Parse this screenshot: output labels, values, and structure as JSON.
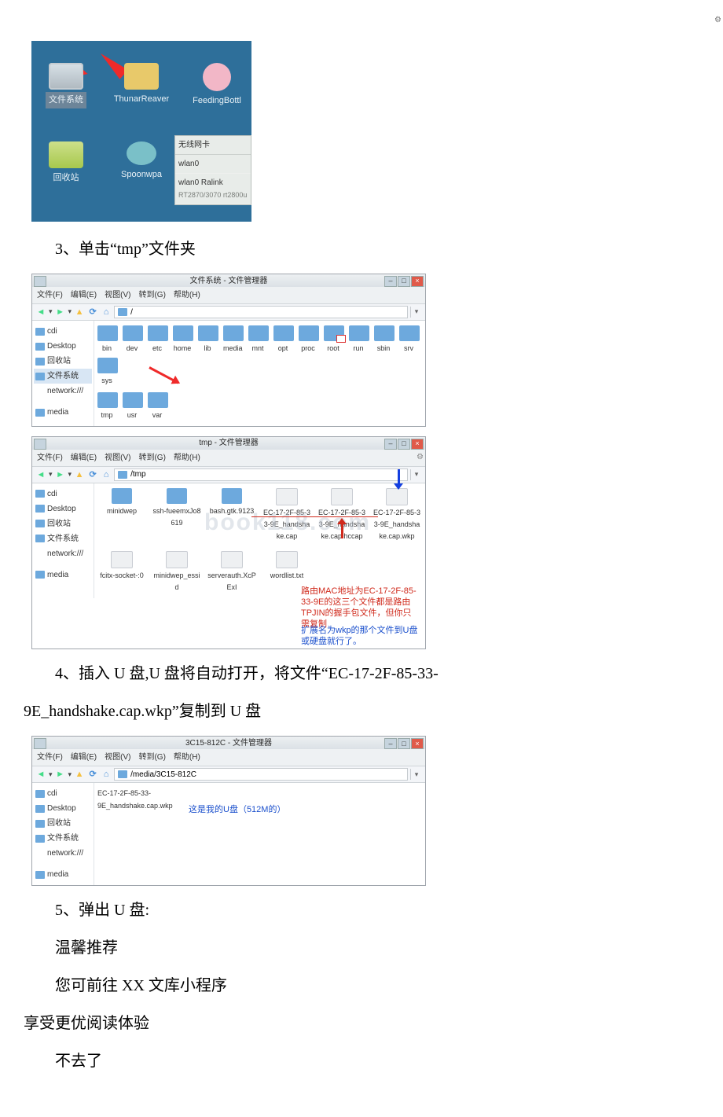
{
  "shot1": {
    "arrow_target": "文件系统",
    "icons": {
      "fs": "文件系统",
      "thunar": "ThunarReaver",
      "feeding": "FeedingBottl",
      "trash": "回收站",
      "spoon": "Spoonwpa"
    },
    "panel": {
      "title": "无线网卡",
      "row1": "wlan0",
      "row2a": "wlan0 Ralink",
      "row2b": "RT2870/3070 rt2800u"
    }
  },
  "p3": "3、单击“tmp”文件夹",
  "fm_root": {
    "title": "文件系统 - 文件管理器",
    "menu": [
      "文件(F)",
      "编辑(E)",
      "视图(V)",
      "转到(G)",
      "帮助(H)"
    ],
    "path": "/",
    "side": [
      "cdi",
      "Desktop",
      "回收站",
      "文件系统",
      "network:///",
      "media"
    ],
    "side_selected": "文件系统",
    "folders_row1": [
      "bin",
      "dev",
      "etc",
      "home",
      "lib",
      "media",
      "mnt",
      "opt",
      "proc",
      "root",
      "run",
      "sbin",
      "srv",
      "sys"
    ],
    "folders_row2": [
      "tmp",
      "usr",
      "var"
    ]
  },
  "fm_tmp": {
    "title": "tmp - 文件管理器",
    "menu": [
      "文件(F)",
      "编辑(E)",
      "视图(V)",
      "转到(G)",
      "帮助(H)"
    ],
    "path": "/tmp",
    "side": [
      "cdi",
      "Desktop",
      "回收站",
      "文件系统",
      "network:///",
      "media"
    ],
    "items_row1": [
      "minidwep",
      "ssh-fueemxJo8619",
      "bash.gtk.9123",
      "EC-17-2F-85-33-9E_handshake.cap",
      "EC-17-2F-85-33-9E_handshake.cap.hccap",
      "EC-17-2F-85-33-9E_handshake.cap.wkp"
    ],
    "items_row2": [
      "fcitx-socket-:0",
      "minidwep_essid",
      "serverauth.XcPExI",
      "wordlist.txt"
    ],
    "watermark": "book118.com",
    "annotation_red": "路由MAC地址为EC-17-2F-85-33-9E的这三个文件都是路由TPJIN的握手包文件，但你只需复制",
    "annotation_blue": "扩展名为wkp的那个文件到U盘或硬盘就行了。"
  },
  "p4a": "4、插入 U 盘,U 盘将自动打开，将文件“EC-17-2F-85-33-",
  "p4b": "9E_handshake.cap.wkp”复制到 U 盘",
  "fm_usb": {
    "title": "3C15-812C - 文件管理器",
    "menu": [
      "文件(F)",
      "编辑(E)",
      "视图(V)",
      "转到(G)",
      "帮助(H)"
    ],
    "path": "/media/3C15-812C",
    "side": [
      "cdi",
      "Desktop",
      "回收站",
      "文件系统",
      "network:///",
      "media"
    ],
    "file": "EC-17-2F-85-33-9E_handshake.cap.wkp",
    "note": "这是我的U盘（512M的）"
  },
  "p5": "5、弹出 U 盘:",
  "p6": "温馨推荐",
  "p7": "您可前往 XX 文库小程序",
  "p8": "享受更优阅读体验",
  "p9": "不去了"
}
